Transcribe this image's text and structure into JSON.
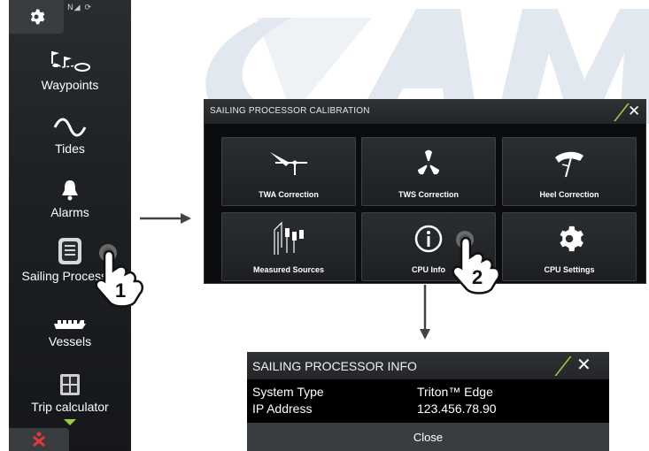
{
  "menu": {
    "status_icons": "N◢ ⟳",
    "items": [
      {
        "label": "Waypoints",
        "icon": "waypoints-icon"
      },
      {
        "label": "Tides",
        "icon": "tides-icon"
      },
      {
        "label": "Alarms",
        "icon": "bell-icon"
      },
      {
        "label": "Sailing Processor",
        "icon": "sailing-processor-icon"
      },
      {
        "label": "Vessels",
        "icon": "vessels-icon"
      },
      {
        "label": "Trip calculator",
        "icon": "calculator-icon"
      }
    ]
  },
  "steps": {
    "one": "1",
    "two": "2"
  },
  "calibration": {
    "title": "SAILING PROCESSOR CALIBRATION",
    "tiles": [
      {
        "label": "TWA Correction",
        "icon": "wind-vane-icon"
      },
      {
        "label": "TWS Correction",
        "icon": "anemometer-icon"
      },
      {
        "label": "Heel Correction",
        "icon": "heel-icon"
      },
      {
        "label": "Measured Sources",
        "icon": "sensors-icon"
      },
      {
        "label": "CPU Info",
        "icon": "info-icon"
      },
      {
        "label": "CPU Settings",
        "icon": "gear-icon"
      }
    ]
  },
  "info": {
    "title": "SAILING PROCESSOR INFO",
    "rows": [
      {
        "key": "System Type",
        "value": "Triton™ Edge"
      },
      {
        "key": "IP Address",
        "value": "123.456.78.90"
      }
    ],
    "close_label": "Close"
  },
  "colors": {
    "accent": "#9fcc3a",
    "panel": "#1e2124",
    "tile": "#2b2e31",
    "watermark": "#dfe6ee"
  }
}
